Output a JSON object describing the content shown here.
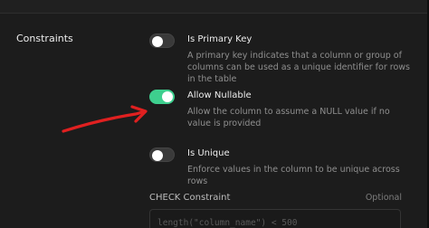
{
  "section": {
    "label": "Constraints"
  },
  "constraints": [
    {
      "title": "Is Primary Key",
      "description": "A primary key indicates that a column or group of columns can be used as a unique identifier for rows in the table",
      "enabled": false
    },
    {
      "title": "Allow Nullable",
      "description": "Allow the column to assume a NULL value if no value is provided",
      "enabled": true
    },
    {
      "title": "Is Unique",
      "description": "Enforce values in the column to be unique across rows",
      "enabled": false
    }
  ],
  "check_constraint": {
    "label": "CHECK Constraint",
    "optional_label": "Optional",
    "placeholder": "length(\"column_name\") < 500"
  },
  "colors": {
    "toggle_on": "#3ecf8e",
    "annotation_arrow": "#e02020"
  },
  "icons": {
    "annotation": "red-arrow-icon"
  }
}
